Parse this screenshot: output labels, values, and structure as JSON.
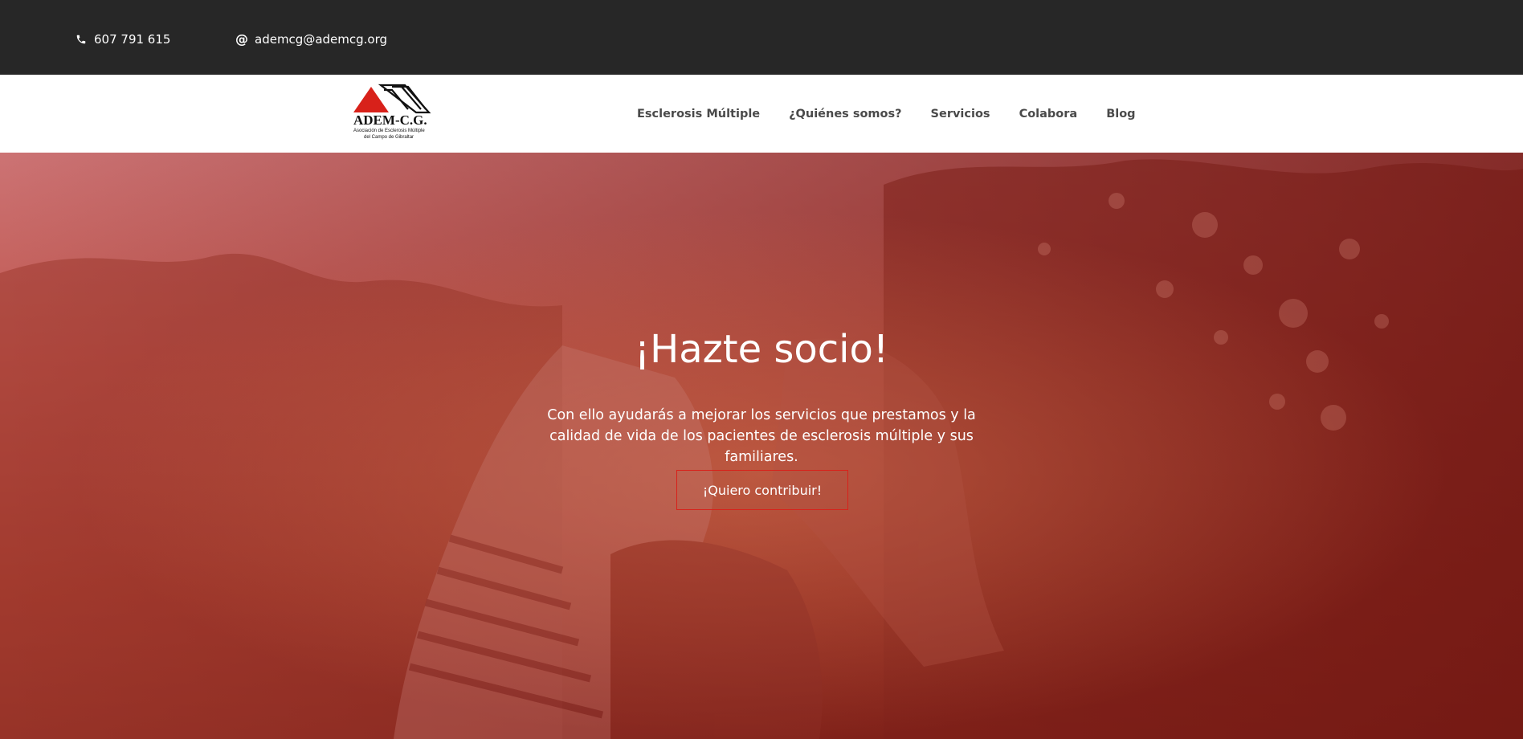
{
  "topbar": {
    "phone": "607 791 615",
    "phone_icon": "phone-icon",
    "email": "ademcg@ademcg.org",
    "email_icon": "at-icon"
  },
  "logo": {
    "name": "ADEM-C.G.",
    "line1": "Asociación de Esclerosis Múltiple",
    "line2": "del Campo de Gibraltar"
  },
  "nav": {
    "items": [
      {
        "label": "Esclerosis Múltiple"
      },
      {
        "label": "¿Quiénes somos?"
      },
      {
        "label": "Servicios"
      },
      {
        "label": "Colabora"
      },
      {
        "label": "Blog"
      }
    ]
  },
  "hero": {
    "title": "¡Hazte socio!",
    "text": "Con ello ayudarás a mejorar los servicios que prestamos y la calidad de vida de los pacientes de esclerosis múltiple y sus familiares.",
    "button_label": "¡Quiero contribuir!"
  },
  "colors": {
    "topbar_bg": "#272727",
    "accent_red": "#d8211a",
    "hero_overlay": "#a83228",
    "nav_text": "#4a4a4a"
  }
}
